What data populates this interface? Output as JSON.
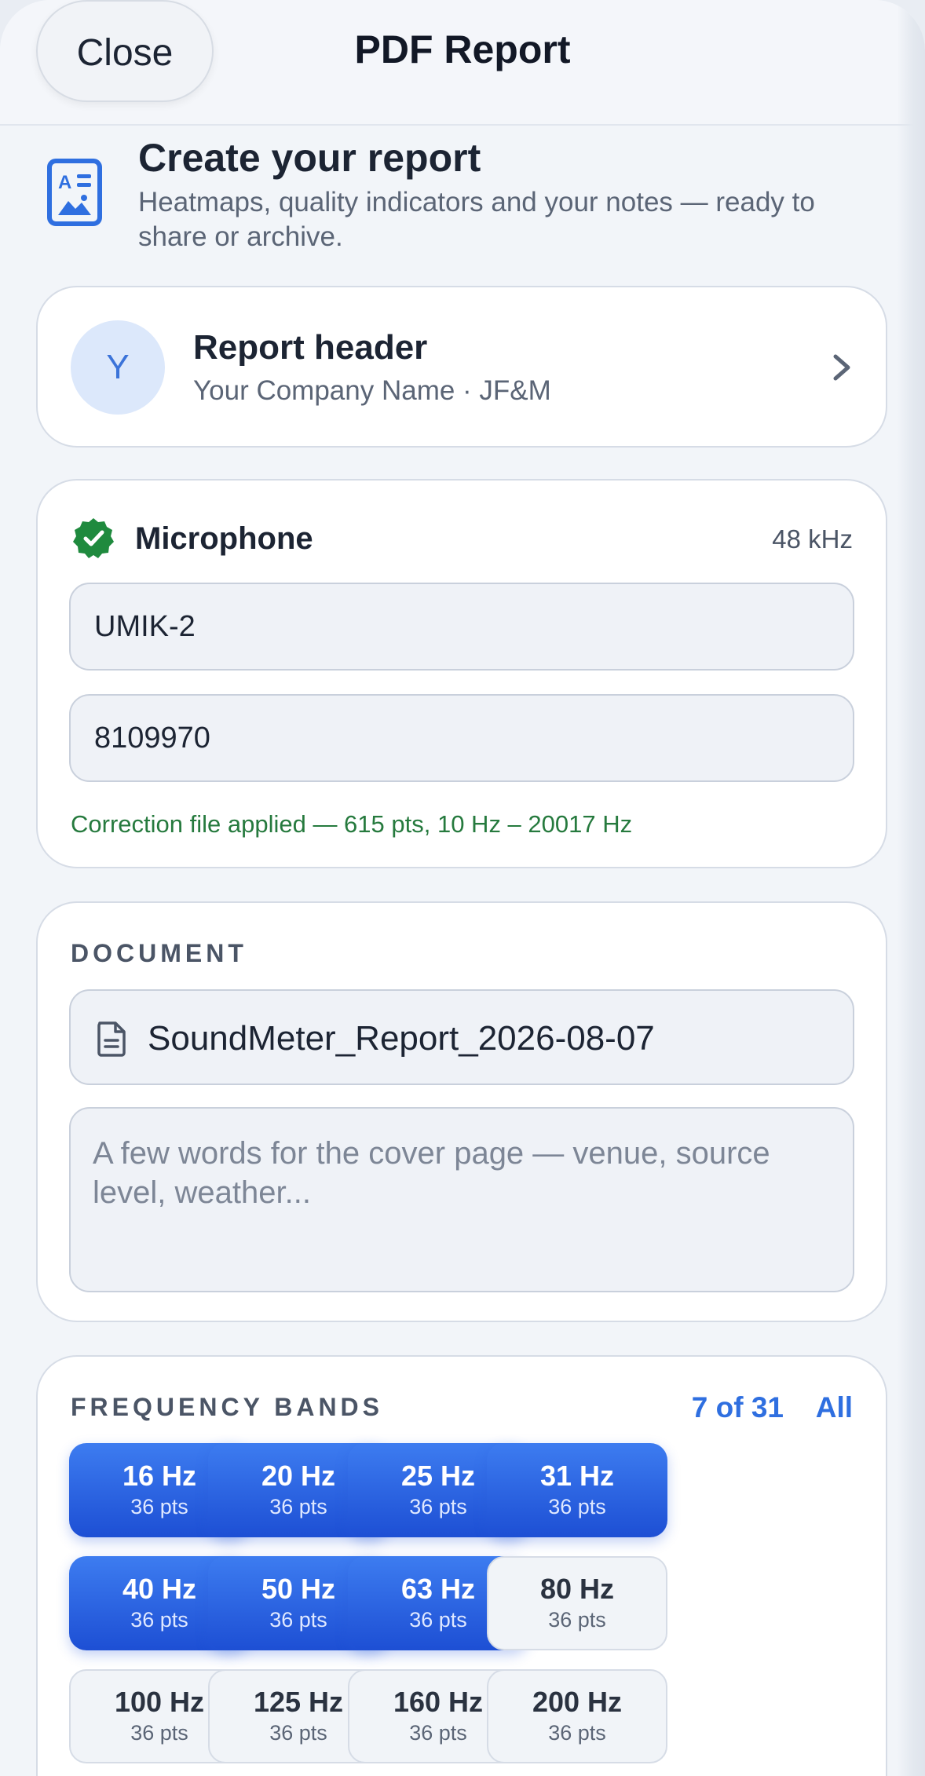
{
  "header": {
    "close_label": "Close",
    "title": "PDF Report"
  },
  "intro": {
    "icon": "report-doc-icon",
    "title": "Create your report",
    "subtitle": "Heatmaps, quality indicators and your notes — ready to share or archive."
  },
  "report_header": {
    "avatar_letter": "Y",
    "title": "Report header",
    "subtitle": "Your Company Name · JF&M"
  },
  "microphone": {
    "title": "Microphone",
    "sample_rate": "48 kHz",
    "model": "UMIK-2",
    "serial": "8109970",
    "correction_note": "Correction file applied — 615 pts, 10 Hz – 20017 Hz",
    "status_color": "#1f8a3e"
  },
  "document": {
    "section_label": "DOCUMENT",
    "file_name": "SoundMeter_Report_2026-08-07",
    "notes_placeholder": "A few words for the cover page — venue, source level, weather..."
  },
  "frequency_bands": {
    "section_label": "FREQUENCY BANDS",
    "count_label": "7 of 31",
    "all_label": "All",
    "accent_color": "#2f6fe0",
    "bands": [
      {
        "hz": "16 Hz",
        "pts": "36 pts",
        "selected": true
      },
      {
        "hz": "20 Hz",
        "pts": "36 pts",
        "selected": true
      },
      {
        "hz": "25 Hz",
        "pts": "36 pts",
        "selected": true
      },
      {
        "hz": "31 Hz",
        "pts": "36 pts",
        "selected": true
      },
      {
        "hz": "40 Hz",
        "pts": "36 pts",
        "selected": true
      },
      {
        "hz": "50 Hz",
        "pts": "36 pts",
        "selected": true
      },
      {
        "hz": "63 Hz",
        "pts": "36 pts",
        "selected": true
      },
      {
        "hz": "80 Hz",
        "pts": "36 pts",
        "selected": false
      },
      {
        "hz": "100 Hz",
        "pts": "36 pts",
        "selected": false
      },
      {
        "hz": "125 Hz",
        "pts": "36 pts",
        "selected": false
      },
      {
        "hz": "160 Hz",
        "pts": "36 pts",
        "selected": false
      },
      {
        "hz": "200 Hz",
        "pts": "36 pts",
        "selected": false
      }
    ]
  }
}
